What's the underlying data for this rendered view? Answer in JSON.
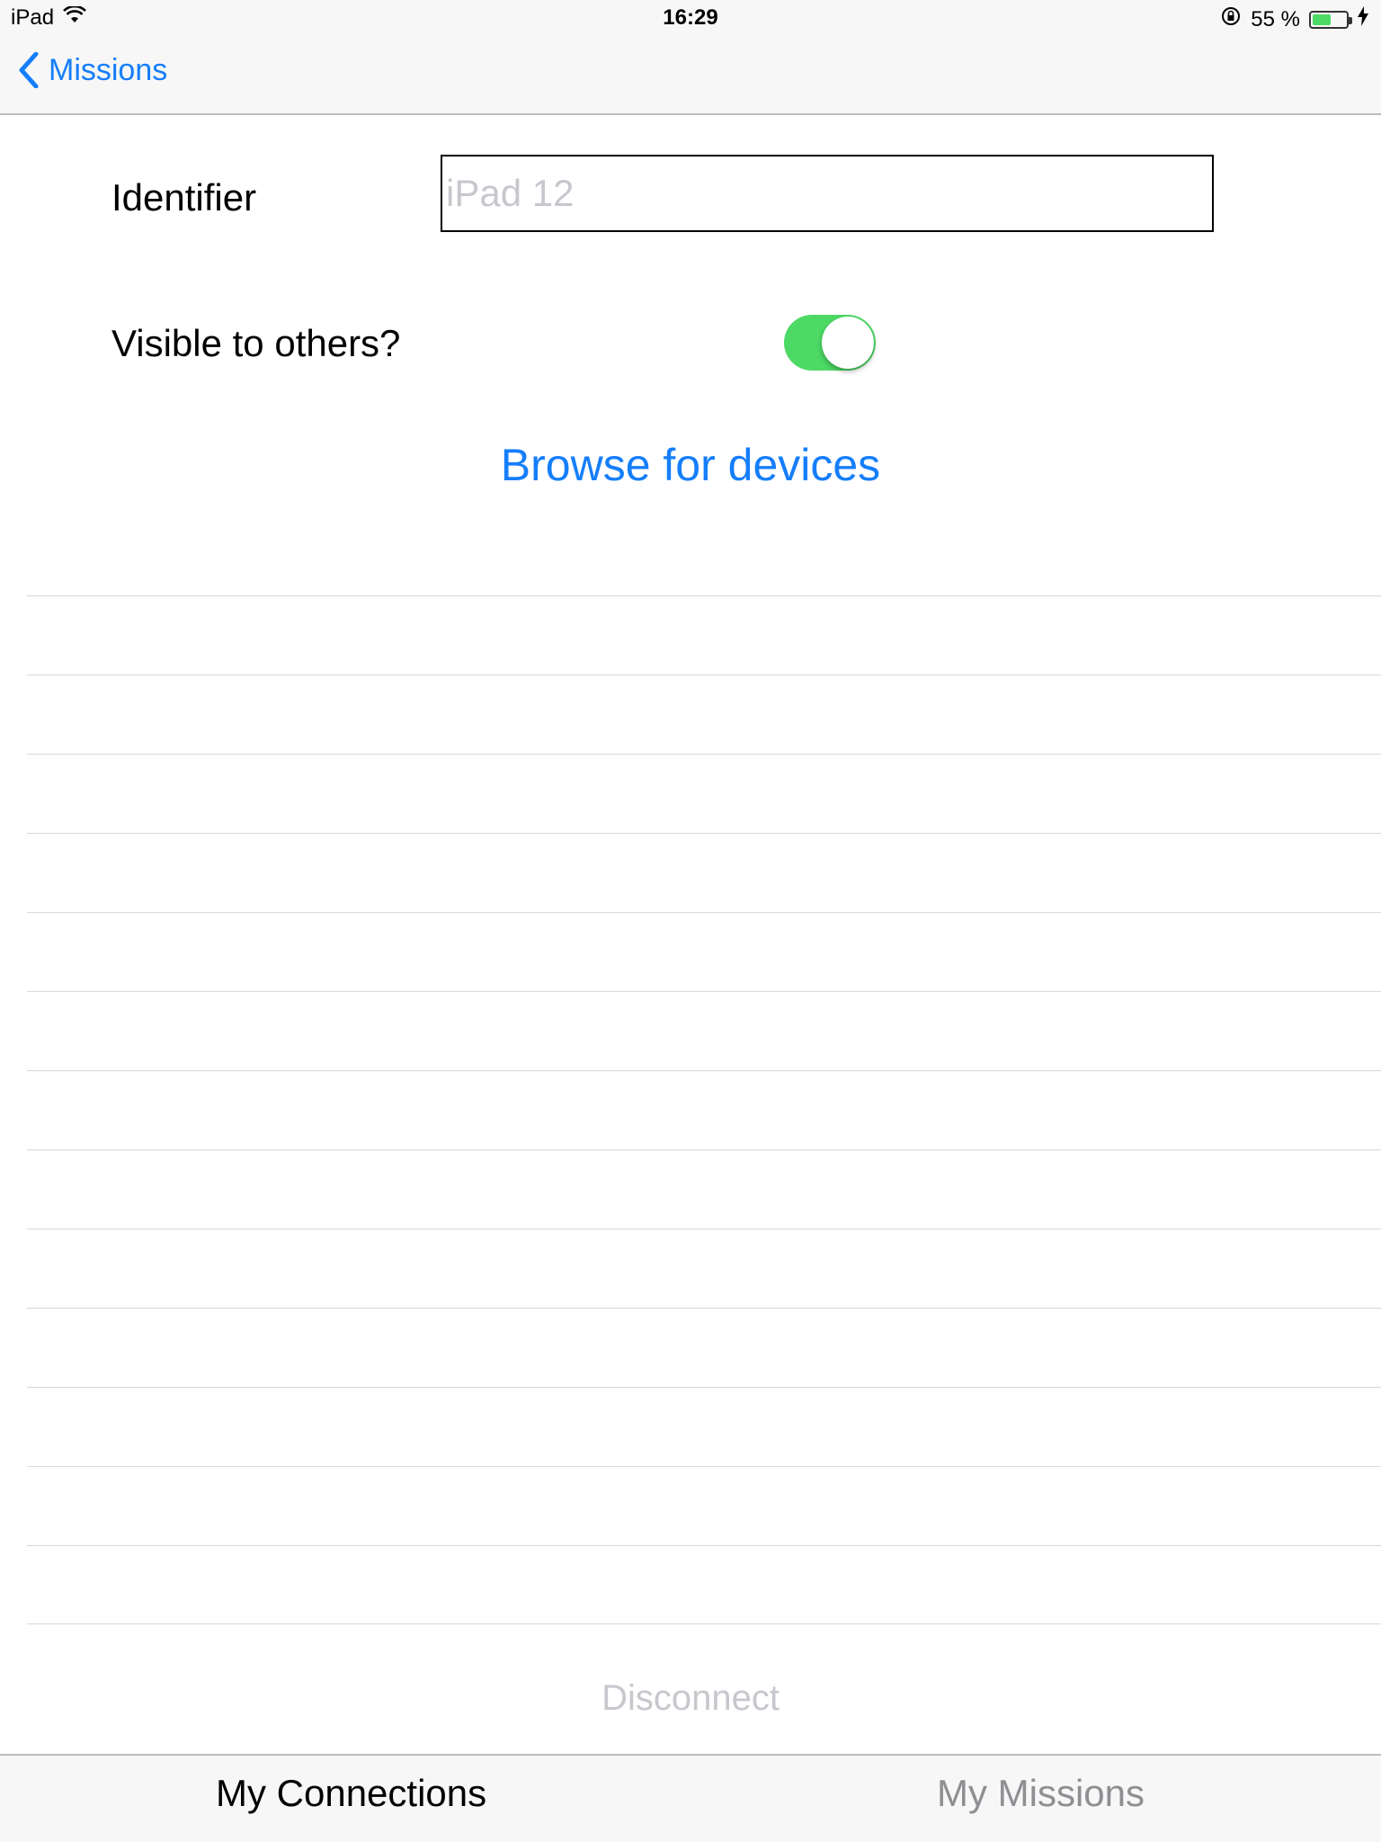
{
  "status_bar": {
    "device": "iPad",
    "time": "16:29",
    "battery_percent_text": "55 %",
    "battery_level": 0.55,
    "icons": [
      "wifi-icon",
      "rotation-lock-icon",
      "battery-icon",
      "charging-bolt-icon"
    ]
  },
  "nav": {
    "back_label": "Missions"
  },
  "form": {
    "identifier_label": "Identifier",
    "identifier_placeholder": "iPad 12",
    "identifier_value": "",
    "visible_label": "Visible to others?",
    "visible_on": true,
    "browse_label": "Browse for devices"
  },
  "devices_list": {
    "rows": [
      "",
      "",
      "",
      "",
      "",
      "",
      "",
      "",
      "",
      "",
      "",
      "",
      ""
    ]
  },
  "disconnect_label": "Disconnect",
  "tabs": [
    {
      "label": "My Connections",
      "selected": true
    },
    {
      "label": "My Missions",
      "selected": false
    }
  ],
  "colors": {
    "accent": "#157efb",
    "toggle_on": "#4cd964",
    "disabled_text": "#c7c7cd",
    "bar_background": "#f7f7f7"
  }
}
